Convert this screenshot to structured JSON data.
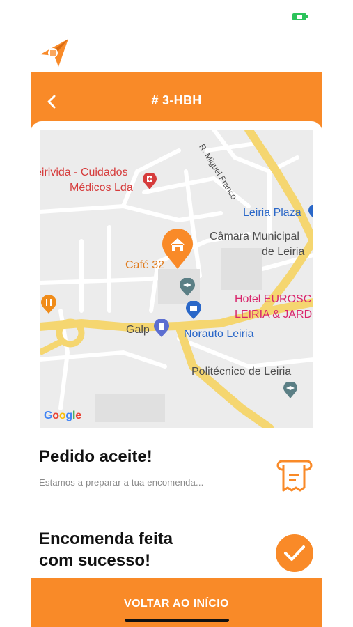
{
  "header": {
    "title": "# 3-HBH"
  },
  "map": {
    "labels": {
      "clinic_line1": "eirivida - Cuidados",
      "clinic_line2": "Médicos Lda",
      "street": "R. Miguel Franco",
      "leiria_plaza": "Leiria Plaza",
      "camara_line1": "Câmara Municipal",
      "camara_line2": "de Leiria",
      "cafe": "Café 32",
      "hotel_line1": "Hotel EUROSC",
      "hotel_line2": "LEIRIA & JARDI",
      "galp": "Galp",
      "norauto": "Norauto Leiria",
      "politecnico": "Politécnico de Leiria"
    },
    "attribution": {
      "g1": "G",
      "o1": "o",
      "o2": "o",
      "g2": "g",
      "l": "l",
      "e": "e"
    }
  },
  "status": {
    "accepted_title": "Pedido aceite!",
    "accepted_sub": "Estamos a preparar a tua encomenda...",
    "ordered_title_line1": "Encomenda feita",
    "ordered_title_line2": "com sucesso!"
  },
  "footer": {
    "button_label": "VOLTAR AO INÍCIO"
  },
  "colors": {
    "accent": "#f98a28",
    "map_bg": "#ececec",
    "road": "#f5d670"
  },
  "icons": [
    "battery-icon",
    "rocket-logo-icon",
    "back-arrow-icon",
    "home-pin-icon",
    "receipt-icon",
    "check-circle-icon",
    "restaurant-icon",
    "school-icon",
    "shopping-icon",
    "gas-station-icon",
    "hospital-icon"
  ]
}
